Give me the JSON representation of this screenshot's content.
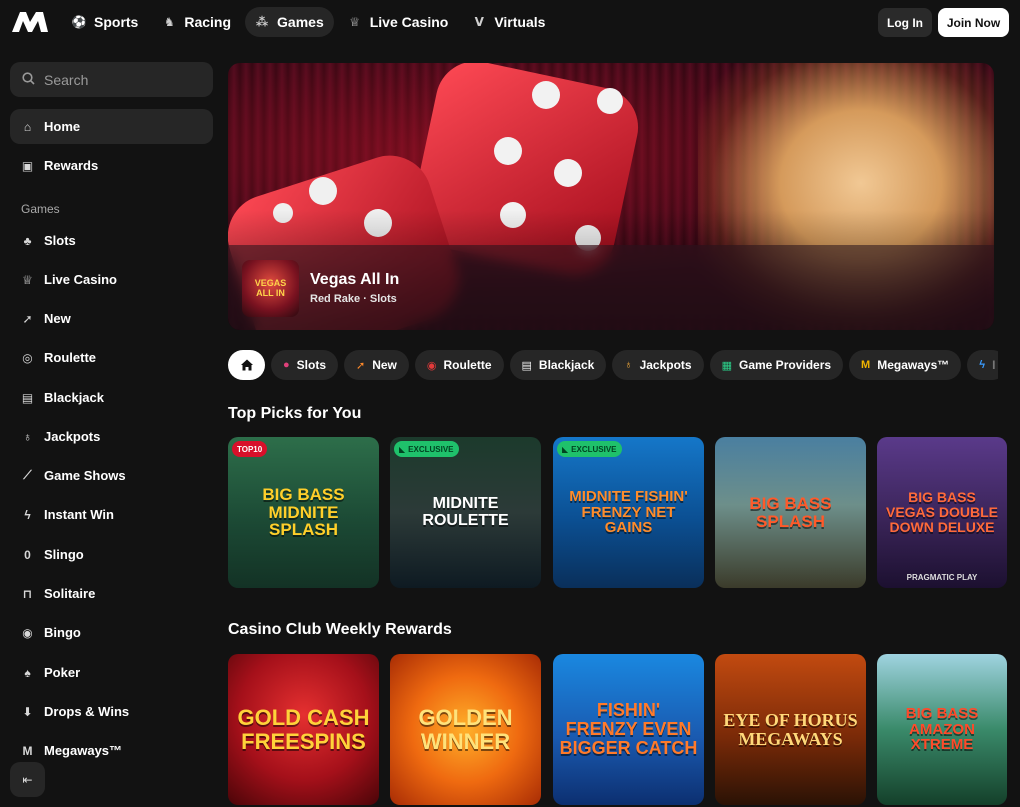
{
  "brand": {
    "logo_text": "M"
  },
  "nav": {
    "items": [
      {
        "label": "Sports",
        "icon": "football-icon"
      },
      {
        "label": "Racing",
        "icon": "horse-icon"
      },
      {
        "label": "Games",
        "icon": "games-icon",
        "active": true
      },
      {
        "label": "Live Casino",
        "icon": "trophy-icon"
      },
      {
        "label": "Virtuals",
        "icon": "virtuals-icon"
      }
    ],
    "login_label": "Log In",
    "join_label": "Join Now"
  },
  "sidebar": {
    "search_placeholder": "Search",
    "primary": [
      {
        "label": "Home",
        "icon": "home-icon",
        "active": true
      },
      {
        "label": "Rewards",
        "icon": "gift-icon"
      }
    ],
    "games_heading": "Games",
    "games": [
      {
        "label": "Slots",
        "icon": "cherry-icon"
      },
      {
        "label": "Live Casino",
        "icon": "trophy-icon"
      },
      {
        "label": "New",
        "icon": "rocket-icon"
      },
      {
        "label": "Roulette",
        "icon": "roulette-icon"
      },
      {
        "label": "Blackjack",
        "icon": "cards-icon"
      },
      {
        "label": "Jackpots",
        "icon": "moneybag-icon"
      },
      {
        "label": "Game Shows",
        "icon": "microphone-icon"
      },
      {
        "label": "Instant Win",
        "icon": "lightning-icon"
      },
      {
        "label": "Slingo",
        "icon": "slingo-icon"
      },
      {
        "label": "Solitaire",
        "icon": "solitaire-icon"
      },
      {
        "label": "Bingo",
        "icon": "bingo-icon"
      },
      {
        "label": "Poker",
        "icon": "poker-icon"
      },
      {
        "label": "Drops & Wins",
        "icon": "drops-icon"
      },
      {
        "label": "Megaways™",
        "icon": "megaways-icon"
      }
    ]
  },
  "hero": {
    "game_title": "Vegas All In",
    "game_subtitle": "Red Rake · Slots",
    "thumb_text": "VEGAS ALL IN"
  },
  "chips": [
    {
      "label": "",
      "icon": "home-icon"
    },
    {
      "label": "Slots",
      "icon": "cherry-icon"
    },
    {
      "label": "New",
      "icon": "rocket-icon"
    },
    {
      "label": "Roulette",
      "icon": "roulette-icon"
    },
    {
      "label": "Blackjack",
      "icon": "cards-icon"
    },
    {
      "label": "Jackpots",
      "icon": "moneybag-icon"
    },
    {
      "label": "Game Providers",
      "icon": "grid-icon"
    },
    {
      "label": "Megaways™",
      "icon": "megaways-icon"
    },
    {
      "label": "I",
      "icon": "lightning-icon"
    }
  ],
  "sections": [
    {
      "title": "Top Picks for You",
      "tiles": [
        {
          "name": "BIG BASS MIDNITE SPLASH",
          "tag": "TOP10"
        },
        {
          "name": "MIDNITE ROULETTE",
          "tag": "EXCLUSIVE"
        },
        {
          "name": "MIDNITE FISHIN' FRENZY NET GAINS",
          "tag": "EXCLUSIVE"
        },
        {
          "name": "BIG BASS SPLASH",
          "tag": ""
        },
        {
          "name": "BIG BASS VEGAS DOUBLE DOWN DELUXE",
          "tag": "",
          "footer": "PRAGMATIC PLAY"
        }
      ]
    },
    {
      "title": "Casino Club Weekly Rewards",
      "tiles": [
        {
          "name": "GOLD CASH FREESPINS",
          "tag": ""
        },
        {
          "name": "GOLDEN WINNER",
          "tag": ""
        },
        {
          "name": "FISHIN' FRENZY EVEN BIGGER CATCH",
          "tag": ""
        },
        {
          "name": "EYE OF HORUS MEGAWAYS",
          "tag": ""
        },
        {
          "name": "BIG BASS AMAZON XTREME",
          "tag": ""
        }
      ]
    }
  ],
  "colors": {
    "background": "#121212",
    "surface": "#262626",
    "accent_red": "#d8102a",
    "accent_green": "#1fc16b"
  }
}
